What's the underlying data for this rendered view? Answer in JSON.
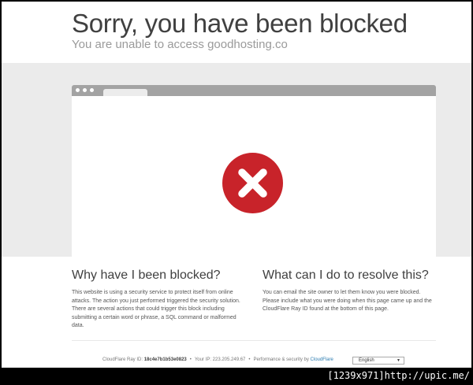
{
  "header": {
    "title": "Sorry, you have been blocked",
    "subtitle": "You are unable to access goodhosting.co"
  },
  "colors": {
    "block_red": "#c8232a",
    "band": "#ebebeb",
    "browser_bar": "#a3a3a3",
    "link": "#2c7cb0"
  },
  "illustration": {
    "icon": "x-circle-icon"
  },
  "left_column": {
    "title": "Why have I been blocked?",
    "text": "This website is using a security service to protect itself from online attacks. The action you just performed triggered the security solution. There are several actions that could trigger this block including submitting a certain word or phrase, a SQL command or malformed data."
  },
  "right_column": {
    "title": "What can I do to resolve this?",
    "text": "You can email the site owner to let them know you were blocked. Please include what you were doing when this page came up and the CloudFlare Ray ID found at the bottom of this page."
  },
  "footer": {
    "ray_label": "CloudFlare Ray ID:",
    "ray_id": "18c4e7b1b53e0823",
    "ip_label": "Your IP:",
    "ip": "223.205.249.67",
    "perf_label": "Performance & security by",
    "perf_link": "CloudFlare",
    "separator": "•",
    "language": "English"
  },
  "watermark": "[1239x971]http://upic.me/"
}
